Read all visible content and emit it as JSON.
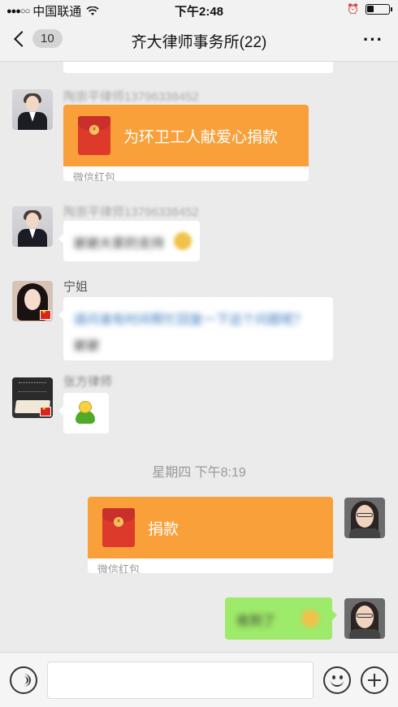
{
  "status_bar": {
    "signal_dots": "●●●○○",
    "carrier": "中国联通",
    "wifi_icon": "wifi-icon",
    "time": "下午2:48",
    "alarm_icon": "⏰",
    "battery_level": 0.3
  },
  "nav": {
    "back_icon": "chevron-left-icon",
    "unread_count": "10",
    "title": "齐大律师事务所(22)",
    "more_label": "···"
  },
  "messages": [
    {
      "sender": "陶崇平律师13796338452",
      "type": "red_packet",
      "title": "为环卫工人献爱心捐款",
      "label": "微信红包"
    },
    {
      "sender": "陶崇平律师13796338452",
      "type": "text",
      "text": "谢谢大家的支持"
    },
    {
      "sender": "宁姐",
      "type": "text",
      "text": "请问谁有时间帮忙回复一下这个问题呢？",
      "text_line2": "谢谢"
    },
    {
      "sender": "张方律师",
      "type": "sticker",
      "sticker": "turtle-sticker"
    }
  ],
  "timestamp": "星期四 下午8:19",
  "my_messages": [
    {
      "type": "red_packet",
      "title": "捐款",
      "label": "微信红包"
    },
    {
      "type": "text",
      "text": "收到了"
    }
  ],
  "input_bar": {
    "voice_icon": "voice-icon",
    "emoji_icon": "emoji-icon",
    "plus_icon": "plus-icon"
  },
  "colors": {
    "red_packet": "#f9a03a",
    "my_bubble": "#9eea6a",
    "background": "#ebebeb"
  }
}
